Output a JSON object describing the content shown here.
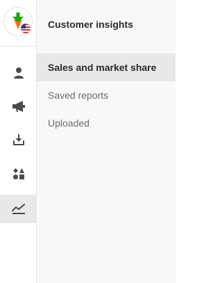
{
  "rail": {
    "logo": {
      "icon": "carrot-logo-icon",
      "flag": "us-flag-icon"
    },
    "items": [
      {
        "icon": "person-icon",
        "active": false
      },
      {
        "icon": "megaphone-icon",
        "active": false
      },
      {
        "icon": "download-tray-icon",
        "active": false
      },
      {
        "icon": "shapes-icon",
        "active": false
      },
      {
        "icon": "trend-chart-icon",
        "active": true
      }
    ]
  },
  "panel": {
    "title": "Customer insights",
    "items": [
      {
        "label": "Sales and market share",
        "active": true
      },
      {
        "label": "Saved reports",
        "active": false
      },
      {
        "label": "Uploaded",
        "active": false
      }
    ]
  },
  "colors": {
    "panel_bg": "#f8f8f8",
    "active_bg": "#e8e8e8",
    "icon": "#4a4a4a",
    "logo_green": "#0aad0a",
    "logo_orange": "#ff7009"
  }
}
